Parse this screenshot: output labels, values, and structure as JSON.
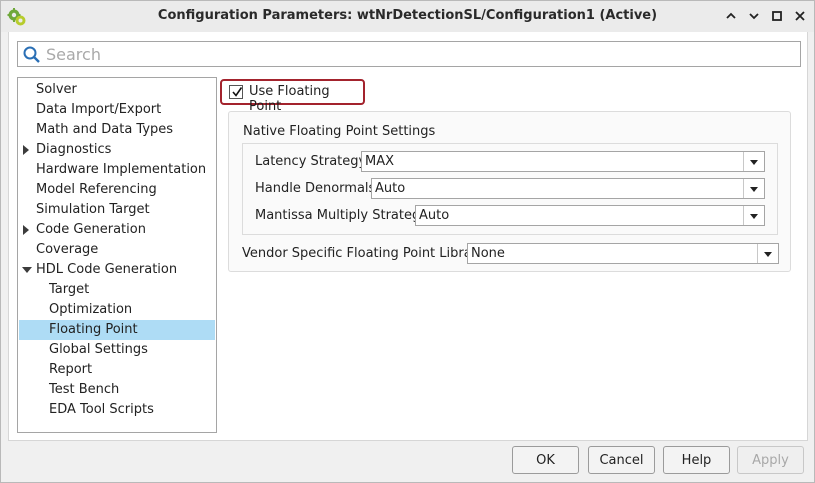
{
  "window": {
    "title": "Configuration Parameters: wtNrDetectionSL/Configuration1 (Active)"
  },
  "search": {
    "placeholder": "Search",
    "value": ""
  },
  "tree": {
    "items": [
      {
        "label": "Solver"
      },
      {
        "label": "Data Import/Export"
      },
      {
        "label": "Math and Data Types"
      },
      {
        "label": "Diagnostics"
      },
      {
        "label": "Hardware Implementation"
      },
      {
        "label": "Model Referencing"
      },
      {
        "label": "Simulation Target"
      },
      {
        "label": "Code Generation"
      },
      {
        "label": "Coverage"
      },
      {
        "label": "HDL Code Generation"
      },
      {
        "label": "Target"
      },
      {
        "label": "Optimization"
      },
      {
        "label": "Floating Point"
      },
      {
        "label": "Global Settings"
      },
      {
        "label": "Report"
      },
      {
        "label": "Test Bench"
      },
      {
        "label": "EDA Tool Scripts"
      }
    ],
    "selected": "Floating Point"
  },
  "panel": {
    "use_floating_point": {
      "label": "Use Floating Point",
      "checked": true
    },
    "native_group_title": "Native Floating Point Settings",
    "latency": {
      "label": "Latency Strategy:",
      "value": "MAX"
    },
    "denormals": {
      "label": "Handle Denormals:",
      "value": "Auto"
    },
    "mantissa": {
      "label": "Mantissa Multiply Strategy:",
      "value": "Auto"
    },
    "vendor": {
      "label": "Vendor Specific Floating Point Library:",
      "value": "None"
    }
  },
  "buttons": {
    "ok": "OK",
    "cancel": "Cancel",
    "help": "Help",
    "apply": "Apply"
  },
  "colors": {
    "selection": "#aedcf5",
    "highlight_border": "#a3232d"
  },
  "icons": {
    "app": "gear-cluster-icon",
    "minimize": "chevron-up-icon",
    "restore": "chevron-down-icon",
    "maximize": "square-icon",
    "close": "close-icon",
    "search": "search-icon"
  }
}
